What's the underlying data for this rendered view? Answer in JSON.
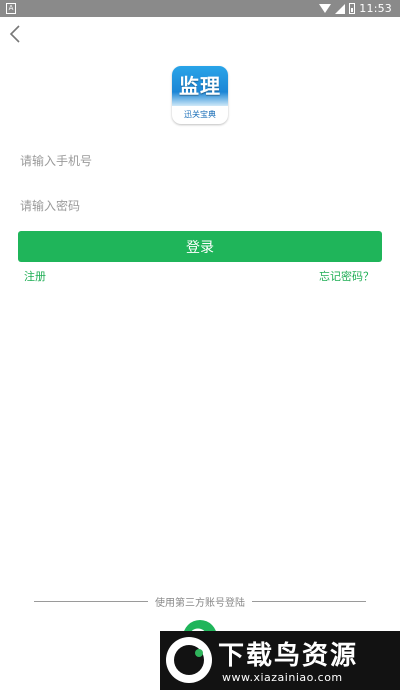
{
  "status_bar": {
    "time": "11:53"
  },
  "logo": {
    "title": "监理",
    "subtitle": "迅关宝典"
  },
  "form": {
    "phone_placeholder": "请输入手机号",
    "password_placeholder": "请输入密码",
    "login_label": "登录",
    "register_label": "注册",
    "forgot_label": "忘记密码？"
  },
  "third_party": {
    "label": "使用第三方账号登陆"
  },
  "watermark": {
    "title": "下载鸟资源",
    "url": "www.xiazainiao.com"
  },
  "colors": {
    "primary": "#1fb55a",
    "link": "#1fae55",
    "status_bar": "#8a8a8a",
    "logo_blue": "#1c86d6"
  },
  "icons": [
    "back-arrow-icon",
    "wifi-icon",
    "signal-icon",
    "battery-icon",
    "wechat-icon"
  ]
}
